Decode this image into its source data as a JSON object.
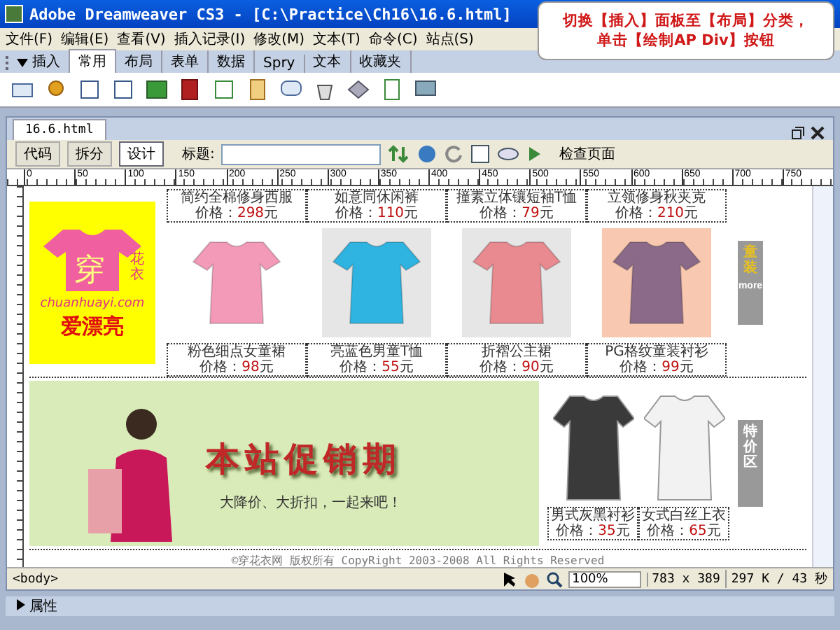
{
  "window": {
    "title": "Adobe Dreamweaver CS3 - [C:\\Practice\\Ch16\\16.6.html]"
  },
  "callout": {
    "lines": [
      "切换【插入】面板至【布局】分类，",
      "单击【绘制AP Div】按钮"
    ]
  },
  "menu": [
    "文件(F)",
    "编辑(E)",
    "查看(V)",
    "插入记录(I)",
    "修改(M)",
    "文本(T)",
    "命令(C)",
    "站点(S)"
  ],
  "insert_panel": {
    "title": "插入",
    "expanded": true,
    "tabs": [
      {
        "label": "常用",
        "selected": true
      },
      {
        "label": "布局",
        "selected": false
      },
      {
        "label": "表单",
        "selected": false
      },
      {
        "label": "数据",
        "selected": false
      },
      {
        "label": "Spry",
        "selected": false
      },
      {
        "label": "文本",
        "selected": false
      },
      {
        "label": "收藏夹",
        "selected": false
      }
    ]
  },
  "document": {
    "tab": "16.6.html",
    "views": [
      {
        "label": "代码",
        "selected": false
      },
      {
        "label": "拆分",
        "selected": false
      },
      {
        "label": "设计",
        "selected": true
      }
    ],
    "title_label": "标题:",
    "check_page": "检查页面",
    "ruler": [
      "0",
      "50",
      "100",
      "150",
      "200",
      "250",
      "300",
      "350",
      "400",
      "450",
      "500",
      "550",
      "600",
      "650",
      "700",
      "750"
    ]
  },
  "page": {
    "logo": {
      "big": "穿",
      "small": "花衣",
      "domain": "chuanhuayi.com",
      "slogan": "爱漂亮"
    },
    "top_products": [
      {
        "name": "简约全棉修身西服",
        "price_label": "价格：",
        "price": "298",
        "unit": "元"
      },
      {
        "name": "如意同休闲裤",
        "price_label": "价格：",
        "price": "110",
        "unit": "元"
      },
      {
        "name": "撞素立体镶短袖T恤",
        "price_label": "价格：",
        "price": "79",
        "unit": "元"
      },
      {
        "name": "立领修身秋夹克",
        "price_label": "价格：",
        "price": "210",
        "unit": "元"
      }
    ],
    "products": [
      {
        "kind": "dress",
        "name": "粉色细点女童裙",
        "price_label": "价格：",
        "price": "98",
        "unit": "元"
      },
      {
        "kind": "polo",
        "name": "亮蓝色男童T恤",
        "price_label": "价格：",
        "price": "55",
        "unit": "元"
      },
      {
        "kind": "frock",
        "name": "折褶公主裙",
        "price_label": "价格：",
        "price": "90",
        "unit": "元"
      },
      {
        "kind": "plaid",
        "name": "PG格纹童装衬衫",
        "price_label": "价格：",
        "price": "99",
        "unit": "元"
      }
    ],
    "kids_tab": {
      "title": "童装",
      "more": "more"
    },
    "banner": {
      "title": "本站促销期",
      "subtitle": "大降价、大折扣，一起来吧！"
    },
    "sale_products": [
      {
        "kind": "dark",
        "name": "男式灰黑衬衫",
        "price_label": "价格：",
        "price": "35",
        "unit": "元"
      },
      {
        "kind": "white",
        "name": "女式白丝上衣",
        "price_label": "价格：",
        "price": "65",
        "unit": "元"
      }
    ],
    "sale_tab": {
      "title": "特价区"
    },
    "footer": "©穿花衣网 版权所有 CopyRight 2003-2008 All Rights Reserved"
  },
  "status_bar": {
    "tag": "<body>",
    "zoom": "100%",
    "size": "783 x 389",
    "download": "297 K / 43 秒"
  },
  "properties_panel": {
    "title": "属性",
    "expanded": false
  }
}
